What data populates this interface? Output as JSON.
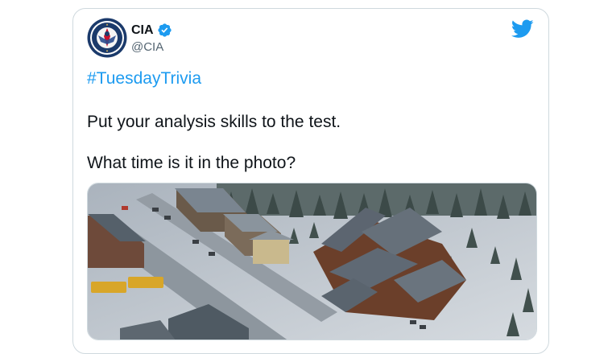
{
  "tweet": {
    "author_name": "CIA",
    "handle": "@CIA",
    "hashtag": "#TuesdayTrivia",
    "text_line1": "Put your analysis skills to the test.",
    "text_line2": "What time is it in the photo?"
  },
  "icons": {
    "avatar": "cia-seal-icon",
    "verified": "verified-badge-icon",
    "brand": "twitter-bird-icon"
  },
  "colors": {
    "accent": "#1d9bf0",
    "text": "#0f1419",
    "secondary": "#536471"
  }
}
